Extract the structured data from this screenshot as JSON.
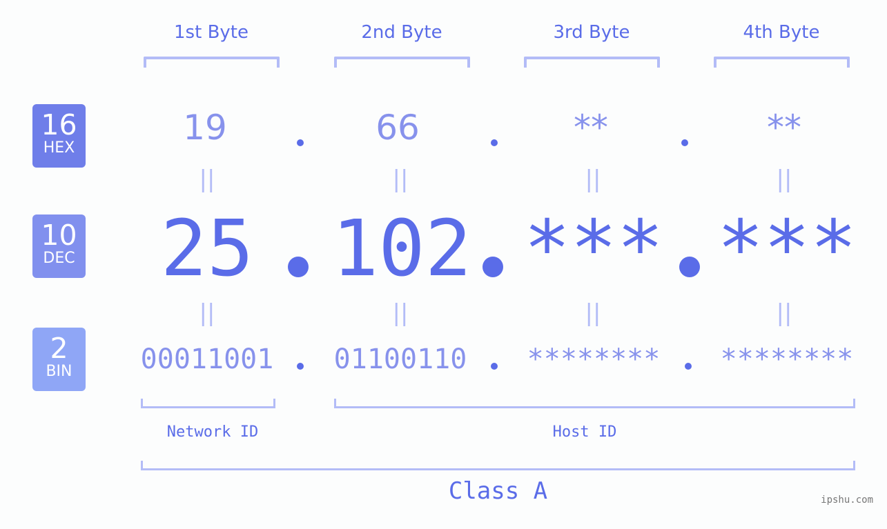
{
  "headers": [
    "1st Byte",
    "2nd Byte",
    "3rd Byte",
    "4th Byte"
  ],
  "rows": {
    "hex": {
      "base": "16",
      "label": "HEX",
      "color": "#6f7ee9",
      "values": [
        "19",
        "66",
        "**",
        "**"
      ]
    },
    "dec": {
      "base": "10",
      "label": "DEC",
      "color": "#8190ee",
      "values": [
        "25",
        "102",
        "***",
        "***"
      ]
    },
    "bin": {
      "base": "2",
      "label": "BIN",
      "color": "#8fa6f6",
      "values": [
        "00011001",
        "01100110",
        "********",
        "********"
      ]
    }
  },
  "equals_symbol": "||",
  "network_id_label": "Network ID",
  "host_id_label": "Host ID",
  "class_label": "Class A",
  "watermark": "ipshu.com",
  "colors": {
    "accent": "#5a6ce8",
    "muted": "#8792ec",
    "bracket": "#b3bcf7"
  }
}
